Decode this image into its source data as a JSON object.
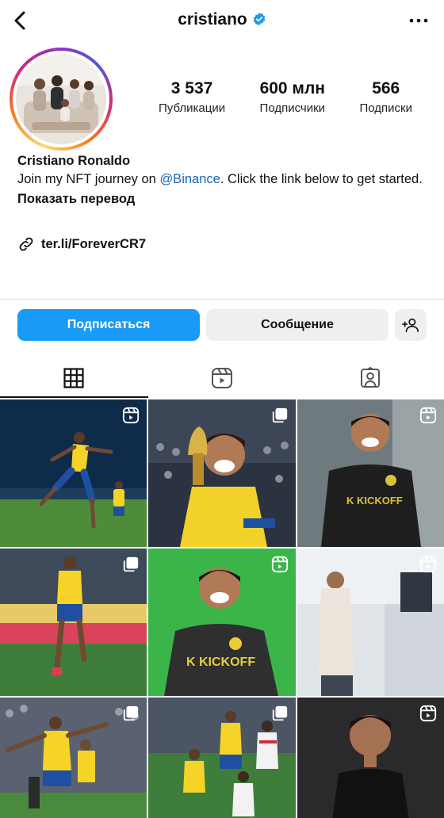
{
  "header": {
    "username": "cristiano",
    "verified": true
  },
  "profile": {
    "stats": [
      {
        "value": "3 537",
        "label": "Публикации"
      },
      {
        "value": "600 млн",
        "label": "Подписчики"
      },
      {
        "value": "566",
        "label": "Подписки"
      }
    ],
    "name": "Cristiano Ronaldo",
    "bio_text_before": "Join my NFT journey on ",
    "bio_mention": "@Binance",
    "bio_text_after": ". Click the link below to get started.",
    "translate_label": "Показать перевод",
    "link": "ter.li/ForeverCR7"
  },
  "actions": {
    "follow_label": "Подписаться",
    "message_label": "Сообщение"
  },
  "tabs": [
    {
      "name": "grid-tab",
      "icon": "grid-icon",
      "active": true
    },
    {
      "name": "reels-tab",
      "icon": "reels-icon",
      "active": false
    },
    {
      "name": "tagged-tab",
      "icon": "tagged-person-icon",
      "active": false
    }
  ],
  "posts": [
    {
      "badge": "reel-icon",
      "scene": "stadium-night"
    },
    {
      "badge": "multi-photo-icon",
      "scene": "trophy-celebration"
    },
    {
      "badge": "reel-icon",
      "scene": "kickoff-promo-dark"
    },
    {
      "badge": "multi-photo-icon",
      "scene": "stadium-day"
    },
    {
      "badge": "reel-icon",
      "scene": "kickoff-promo-green"
    },
    {
      "badge": "reel-icon",
      "scene": "pestana-hotel"
    },
    {
      "badge": "multi-photo-icon",
      "scene": "team-celebration"
    },
    {
      "badge": "multi-photo-icon",
      "scene": "match-action"
    },
    {
      "badge": "reel-icon",
      "scene": "portrait-dark"
    }
  ],
  "colors": {
    "follow_button": "#1a9af7",
    "secondary_button": "#efefef",
    "mention": "#1a62b8",
    "verified": "#1d9bf0"
  }
}
